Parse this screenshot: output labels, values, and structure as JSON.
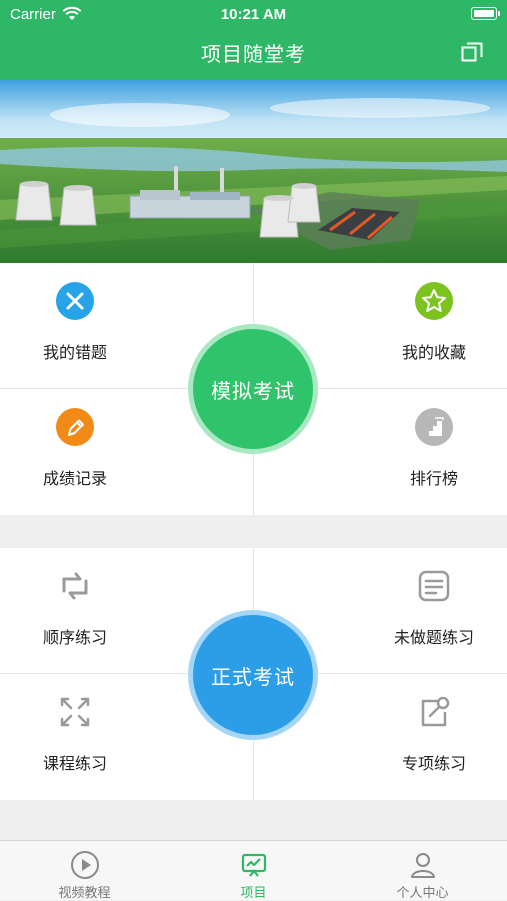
{
  "status_bar": {
    "carrier": "Carrier",
    "time": "10:21 AM"
  },
  "header": {
    "title": "项目随堂考"
  },
  "practice_mock": {
    "center_label": "模拟考试",
    "items": [
      {
        "label": "我的错题",
        "icon": "wrong-answers-icon",
        "color": "#27a3e8"
      },
      {
        "label": "我的收藏",
        "icon": "favorites-star-icon",
        "color": "#7cc31f"
      },
      {
        "label": "成绩记录",
        "icon": "score-record-icon",
        "color": "#f18a17"
      },
      {
        "label": "排行榜",
        "icon": "ranking-icon",
        "color": "#b7b7b7"
      }
    ]
  },
  "practice_formal": {
    "center_label": "正式考试",
    "items": [
      {
        "label": "顺序练习",
        "icon": "sequential-practice-icon"
      },
      {
        "label": "未做题练习",
        "icon": "unanswered-practice-icon"
      },
      {
        "label": "课程练习",
        "icon": "course-practice-icon"
      },
      {
        "label": "专项练习",
        "icon": "special-practice-icon"
      }
    ]
  },
  "tabbar": {
    "items": [
      {
        "label": "视频教程",
        "icon": "video-play-icon"
      },
      {
        "label": "项目",
        "icon": "project-icon",
        "active": true
      },
      {
        "label": "个人中心",
        "icon": "person-icon"
      }
    ]
  },
  "colors": {
    "primary_green": "#2eb766",
    "mock_circle": "#2fc46c",
    "formal_circle": "#2c9ee8"
  }
}
